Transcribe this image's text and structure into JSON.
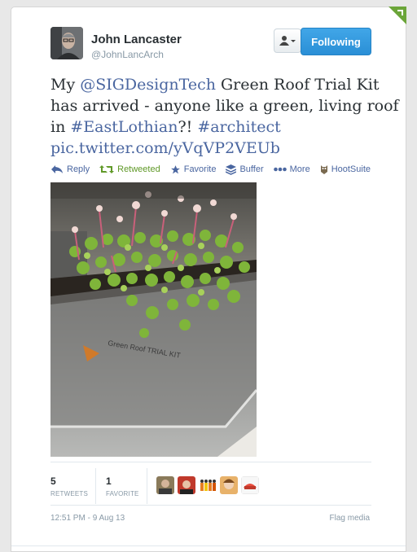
{
  "user": {
    "name": "John Lancaster",
    "handle": "@JohnLancArch"
  },
  "follow_button": {
    "label": "Following"
  },
  "tweet": {
    "parts": [
      {
        "text": "My ",
        "type": "text"
      },
      {
        "text": "@SIGDesignTech",
        "type": "link"
      },
      {
        "text": " Green Roof Trial Kit",
        "type": "text"
      },
      {
        "text": "has arrived - anyone like a green, living roof",
        "type": "text"
      },
      {
        "text": "in ",
        "type": "text"
      },
      {
        "text": "#EastLothian",
        "type": "link"
      },
      {
        "text": "?! ",
        "type": "text"
      },
      {
        "text": "#architect",
        "type": "link"
      },
      {
        "text": "pic.twitter.com/yVqVP2VEUb",
        "type": "link"
      }
    ]
  },
  "actions": {
    "reply": "Reply",
    "retweeted": "Retweeted",
    "favorite": "Favorite",
    "buffer": "Buffer",
    "more": "More",
    "hootsuite": "HootSuite"
  },
  "photo_text": "Green Roof TRIAL KIT",
  "stats": {
    "retweets_count": "5",
    "retweets_label": "RETWEETS",
    "favorites_count": "1",
    "favorites_label": "FAVORITE"
  },
  "footer": {
    "timestamp": "12:51 PM - 9 Aug 13",
    "flag_media": "Flag media"
  },
  "colors": {
    "link": "#4a66a0",
    "follow_button": "#2a8fd6",
    "retweeted": "#609928"
  }
}
